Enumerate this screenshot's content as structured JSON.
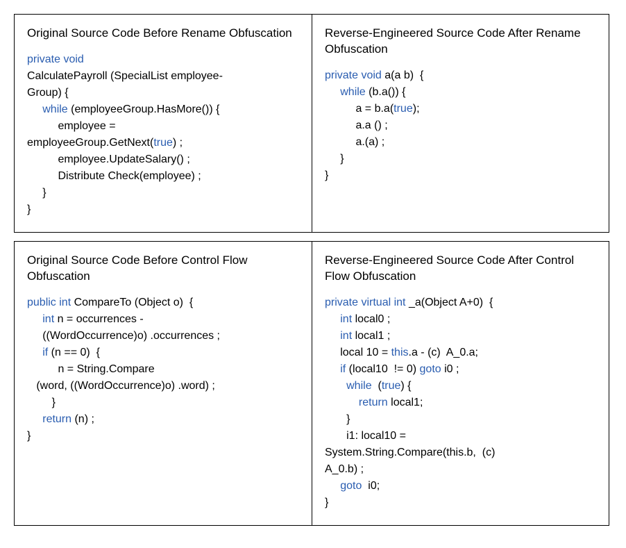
{
  "rows": [
    {
      "left": {
        "heading": "Original Source Code Before\nRename Obfuscation",
        "code": [
          {
            "t": "kw",
            "v": "private void"
          },
          {
            "t": "",
            "v": "\nCalculatePayroll (SpecialList employee-\nGroup) {\n     "
          },
          {
            "t": "kw",
            "v": "while"
          },
          {
            "t": "",
            "v": " (employeeGroup.HasMore()) {\n          employee =\nemployeeGroup.GetNext("
          },
          {
            "t": "kw",
            "v": "true"
          },
          {
            "t": "",
            "v": ") ;\n          employee.UpdateSalary() ;\n          Distribute Check(employee) ;\n     }\n}"
          }
        ]
      },
      "right": {
        "heading": "Reverse-Engineered Source Code\nAfter Rename Obfuscation",
        "code": [
          {
            "t": "kw",
            "v": "private void"
          },
          {
            "t": "",
            "v": " a(a b)  {\n     "
          },
          {
            "t": "kw",
            "v": "while"
          },
          {
            "t": "",
            "v": " (b.a()) {\n          a = b.a("
          },
          {
            "t": "kw",
            "v": "true"
          },
          {
            "t": "",
            "v": ");\n          a.a () ;\n          a.(a) ;\n     }\n}"
          }
        ]
      }
    },
    {
      "left": {
        "heading": "Original Source Code Before\nControl Flow Obfuscation",
        "code": [
          {
            "t": "kw",
            "v": "public int"
          },
          {
            "t": "",
            "v": " CompareTo (Object o)  {\n     "
          },
          {
            "t": "kw",
            "v": "int"
          },
          {
            "t": "",
            "v": " n = occurrences -\n     ((WordOccurrence)o) .occurrences ;\n     "
          },
          {
            "t": "kw",
            "v": "if"
          },
          {
            "t": "",
            "v": " (n == 0)  {\n          n = String.Compare\n   (word, ((WordOccurrence)o) .word) ;\n        }\n     "
          },
          {
            "t": "kw",
            "v": "return"
          },
          {
            "t": "",
            "v": " (n) ;\n}"
          }
        ]
      },
      "right": {
        "heading": "Reverse-Engineered Source Code\nAfter Control Flow Obfuscation",
        "code": [
          {
            "t": "kw",
            "v": "private virtual int"
          },
          {
            "t": "",
            "v": " _a(Object A+0)  {\n     "
          },
          {
            "t": "kw",
            "v": "int"
          },
          {
            "t": "",
            "v": " local0 ;\n     "
          },
          {
            "t": "kw",
            "v": "int"
          },
          {
            "t": "",
            "v": " local1 ;\n     local 10 = "
          },
          {
            "t": "kw",
            "v": "this"
          },
          {
            "t": "",
            "v": ".a - (c)  A_0.a;\n     "
          },
          {
            "t": "kw",
            "v": "if"
          },
          {
            "t": "",
            "v": " (local10  != 0) "
          },
          {
            "t": "kw",
            "v": "goto"
          },
          {
            "t": "",
            "v": " i0 ;\n       "
          },
          {
            "t": "kw",
            "v": "while"
          },
          {
            "t": "",
            "v": "  ("
          },
          {
            "t": "kw",
            "v": "true"
          },
          {
            "t": "",
            "v": ") {\n           "
          },
          {
            "t": "kw",
            "v": "return"
          },
          {
            "t": "",
            "v": " local1;\n       }\n       i1: local10 =\nSystem.String.Compare(this.b,  (c)\nA_0.b) ;\n     "
          },
          {
            "t": "kw",
            "v": "goto"
          },
          {
            "t": "",
            "v": "  i0;\n}"
          }
        ]
      }
    }
  ]
}
